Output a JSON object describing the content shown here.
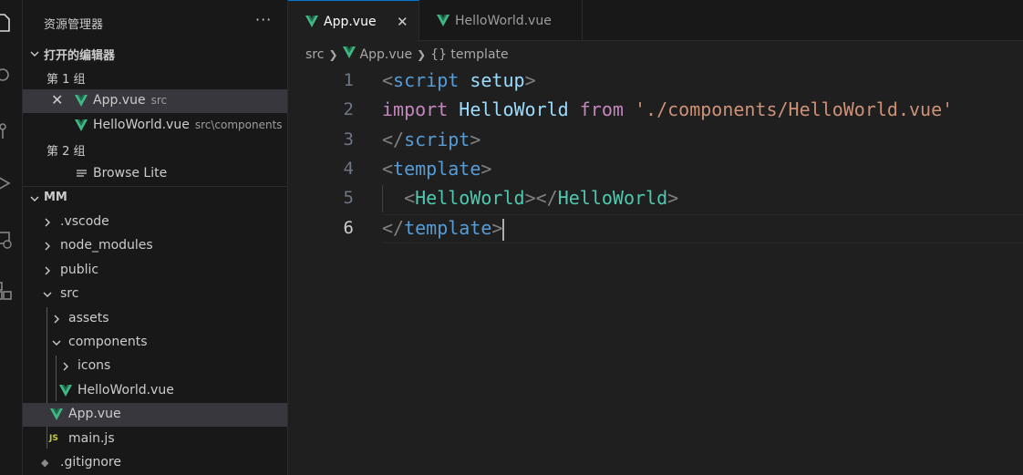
{
  "sidebar": {
    "title": "资源管理器",
    "more": "···",
    "open_editors": {
      "header": "打开的编辑器",
      "group1": "第 1 组",
      "group1_files": [
        {
          "name": "App.vue",
          "hint": "src"
        },
        {
          "name": "HelloWorld.vue",
          "hint": "src\\components"
        }
      ],
      "group2": "第 2 组",
      "group2_files": [
        {
          "name": "Browse Lite"
        }
      ]
    },
    "project": {
      "header": "MM",
      "tree": [
        ".vscode",
        "node_modules",
        "public",
        "src",
        "assets",
        "components",
        "icons",
        "HelloWorld.vue",
        "App.vue",
        "main.js",
        ".gitignore"
      ]
    }
  },
  "tabs": [
    {
      "label": "App.vue",
      "active": true
    },
    {
      "label": "HelloWorld.vue",
      "active": false
    }
  ],
  "breadcrumb": [
    "src",
    "App.vue",
    "{} template"
  ],
  "code_lines": [
    "1",
    "2",
    "3",
    "4",
    "5",
    "6"
  ],
  "code": {
    "l1": [
      "<",
      "script",
      " ",
      "setup",
      ">"
    ],
    "l2": [
      "import",
      " ",
      "HelloWorld",
      " ",
      "from",
      " ",
      "'./components/HelloWorld.vue'"
    ],
    "l3": [
      "</",
      "script",
      ">"
    ],
    "l4": [
      "<",
      "template",
      ">"
    ],
    "l5": [
      "  ",
      "<",
      "HelloWorld",
      ">",
      "</",
      "HelloWorld",
      ">"
    ],
    "l6": [
      "</",
      "template",
      ">"
    ]
  },
  "colors": {
    "vue_green": "#41b883",
    "accent": "#0078d4",
    "js_yellow": "#cbcb41"
  }
}
